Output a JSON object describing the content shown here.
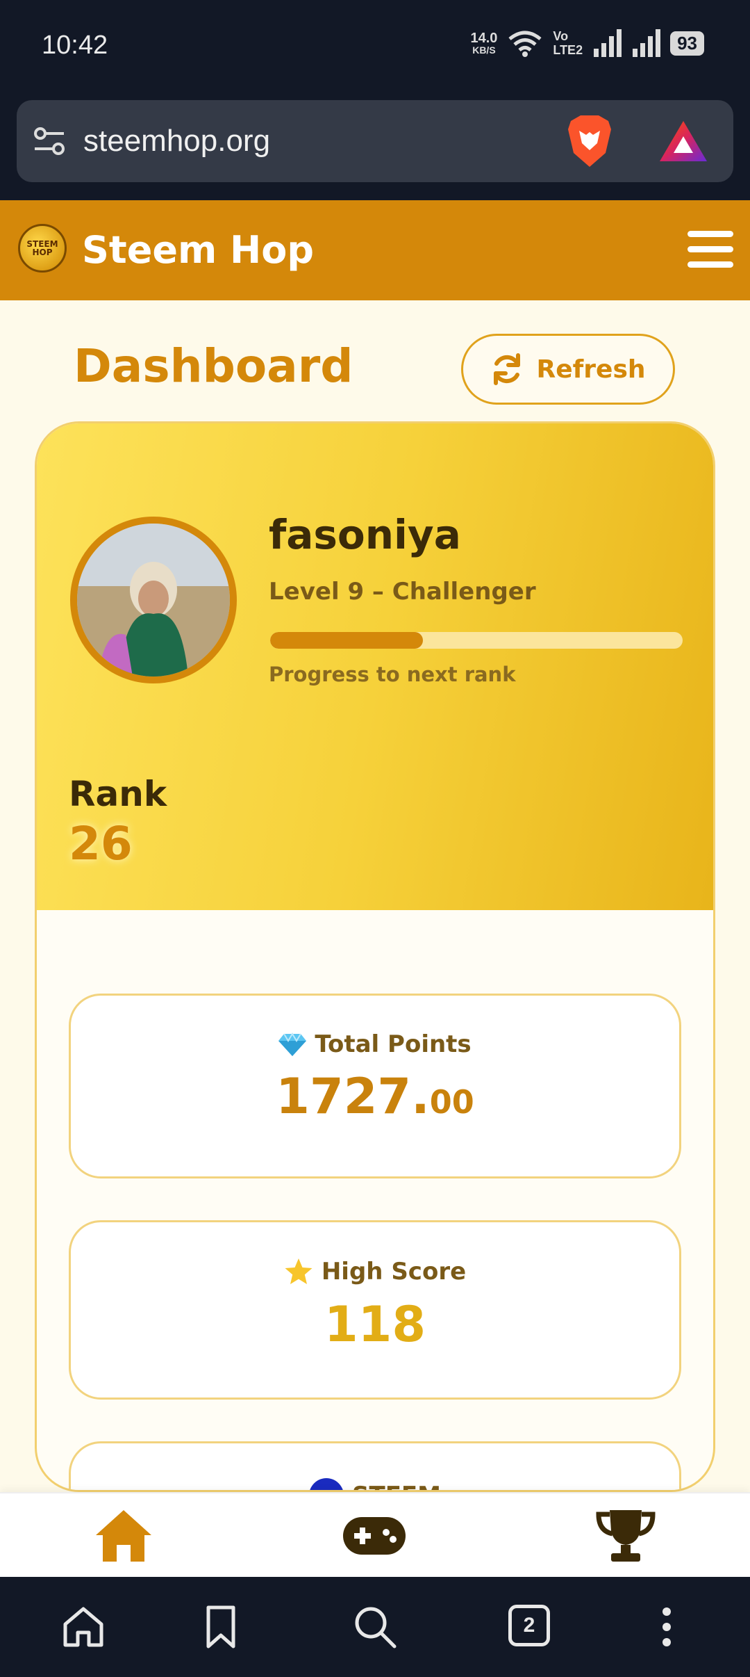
{
  "status_bar": {
    "time": "10:42",
    "net_speed": "14.0",
    "net_unit": "KB/S",
    "volte_top": "Vo",
    "volte_bottom": "LTE2",
    "battery": "93"
  },
  "browser": {
    "url": "steemhop.org",
    "tabs_count": "2"
  },
  "site": {
    "title": "Steem Hop",
    "logo_text": "STEEM HOP"
  },
  "dashboard": {
    "title": "Dashboard",
    "refresh_label": "Refresh"
  },
  "profile": {
    "username": "fasoniya",
    "level": "Level 9 – Challenger",
    "progress_label": "Progress to next rank",
    "progress_fraction": 0.37,
    "rank_label": "Rank",
    "rank_value": "26"
  },
  "stats": {
    "points_label": "Total Points",
    "points_int": "1727.",
    "points_dec": "00",
    "score_label": "High Score",
    "score_value": "118",
    "steem_label": "STEEM"
  },
  "colors": {
    "accent": "#d4880a",
    "header": "#d4880a",
    "card_gradient_start": "#fde25a",
    "card_gradient_end": "#e8b41a",
    "browser_dark": "#121826"
  },
  "icons": [
    "url-settings-icon",
    "brave-lion-icon",
    "brave-rewards-icon",
    "menu-icon",
    "refresh-icon",
    "gem-icon",
    "star-icon",
    "steem-icon",
    "home-icon",
    "gamepad-icon",
    "trophy-icon",
    "bookmark-icon",
    "search-icon",
    "more-icon"
  ]
}
